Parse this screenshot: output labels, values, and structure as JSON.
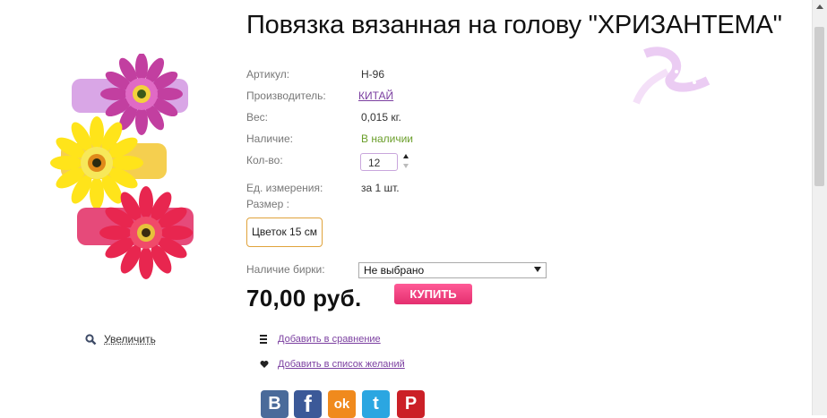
{
  "product": {
    "title": "Повязка вязанная на голову \"ХРИЗАНТЕМА\"",
    "image_alt": "flower-headbands-image"
  },
  "attributes": [
    {
      "label": "Артикул:",
      "value": "Н-96"
    },
    {
      "label": "Производитель:",
      "value": "КИТАЙ"
    },
    {
      "label": "Вес:",
      "value": "0,015 кг."
    },
    {
      "label": "Наличие:",
      "value": "В наличии"
    },
    {
      "label": "Кол-во:",
      "value": "12"
    },
    {
      "label": "Ед. измерения:",
      "value": "за 1 шт."
    },
    {
      "label": "Размер :",
      "value": ""
    }
  ],
  "size_option": "Цветок 15 см",
  "tag": {
    "label": "Наличие бирки:",
    "selected": "Не выбрано"
  },
  "price": "70,00 руб.",
  "buy_label": "КУПИТЬ",
  "zoom_label": "Увеличить",
  "actions": {
    "compare": "Добавить в сравнение",
    "wishlist": "Добавить в список желаний"
  },
  "social": [
    {
      "name": "vkontakte",
      "glyph": "B",
      "color": "#4a6b9a"
    },
    {
      "name": "facebook",
      "glyph": "f",
      "color": "#3b5998"
    },
    {
      "name": "odnoklassniki",
      "glyph": "ok",
      "color": "#f08a1d"
    },
    {
      "name": "twitter",
      "glyph": "t",
      "color": "#2ba6e1"
    },
    {
      "name": "pinterest",
      "glyph": "P",
      "color": "#cb2027"
    }
  ],
  "colors": {
    "accent_link": "#7b3fa0",
    "in_stock": "#6a9e2a",
    "buy_button": "#e42f6f",
    "size_border": "#e0a33b"
  }
}
